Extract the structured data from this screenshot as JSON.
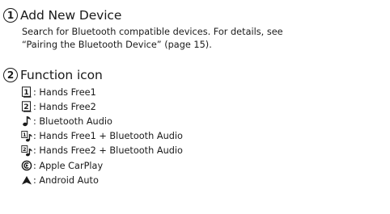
{
  "section1": {
    "number": "1",
    "title": "Add New Device",
    "description_line1": "Search for Bluetooth compatible devices. For details, see",
    "description_line2": "“Pairing the Bluetooth Device” (page 15)."
  },
  "section2": {
    "number": "2",
    "title": "Function icon",
    "items": [
      {
        "icon": "hands-free-1-icon",
        "label": ": Hands Free1"
      },
      {
        "icon": "hands-free-2-icon",
        "label": ": Hands Free2"
      },
      {
        "icon": "bluetooth-audio-icon",
        "label": ": Bluetooth Audio"
      },
      {
        "icon": "hands-free-1-audio-icon",
        "label": ": Hands Free1 + Bluetooth Audio"
      },
      {
        "icon": "hands-free-2-audio-icon",
        "label": ": Hands Free2 + Bluetooth Audio"
      },
      {
        "icon": "apple-carplay-icon",
        "label": ": Apple CarPlay"
      },
      {
        "icon": "android-auto-icon",
        "label": ": Android Auto"
      }
    ]
  }
}
